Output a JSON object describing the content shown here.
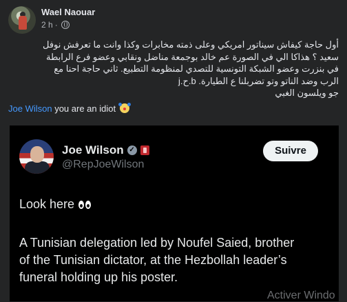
{
  "post": {
    "author": "Wael Naouar",
    "time": "2 h",
    "separator": "·",
    "text_lines": [
      "أول حاجة كيفاش سيناتور امريكي وعلى ذمته مخابرات وكذا وانت ما تعرفش نوفل",
      "سعيد ؟ هذاكا الي في الصورة عم خالد بوجمعة مناضل ونقابي وعضو فرع الرابطة",
      "في بنزرت وعضو الشبكة التونسية للتصدي لمنظومة التطبيع. ثاني حاجة احنا مع",
      "الرب وضد الناتو وتو تضربلنا ع الطيارة. b.ح.j",
      "جو ويلسون الغبي"
    ],
    "mention": "Joe Wilson",
    "mention_suffix": " you are an idiot"
  },
  "tweet": {
    "name": "Joe Wilson",
    "handle": "@RepJoeWilson",
    "follow_label": "Suivre",
    "line1": "Look here",
    "body_lines": [
      "A Tunisian delegation led by Noufel Saied, brother",
      "of the Tunisian dictator, at the Hezbollah leader’s",
      "funeral holding up his poster."
    ]
  },
  "watermark": "Activer Windo",
  "icons": {
    "globe": "globe-icon",
    "clown": "clown-emoji-icon",
    "verified": "verified-badge-icon",
    "gov": "government-flag-icon",
    "eyes": "eyes-emoji-icon"
  },
  "colors": {
    "background": "#242526",
    "mention": "#4599ff",
    "tweet_bg": "#000000",
    "follow_bg": "#eff3f4"
  }
}
